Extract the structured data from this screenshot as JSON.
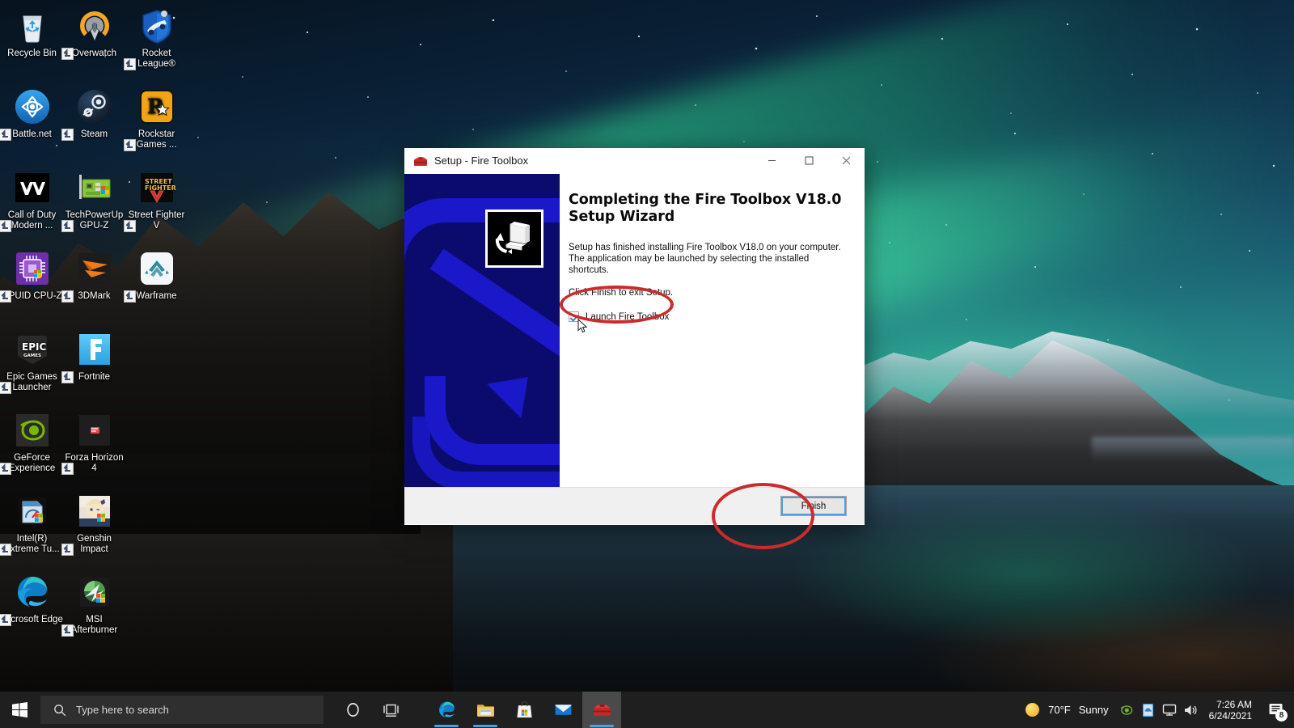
{
  "desktop": {
    "icons": [
      {
        "label": "Recycle Bin",
        "icon": "recycle-bin-icon",
        "shortcut": false,
        "col": 0,
        "row": 0
      },
      {
        "label": "Overwatch",
        "icon": "overwatch-icon",
        "shortcut": true,
        "col": 1,
        "row": 0
      },
      {
        "label": "Rocket League®",
        "icon": "rocket-league-icon",
        "shortcut": true,
        "col": 2,
        "row": 0
      },
      {
        "label": "Battle.net",
        "icon": "battlenet-icon",
        "shortcut": true,
        "col": 0,
        "row": 1
      },
      {
        "label": "Steam",
        "icon": "steam-icon",
        "shortcut": true,
        "col": 1,
        "row": 1
      },
      {
        "label": "Rockstar Games ...",
        "icon": "rockstar-games-icon",
        "shortcut": true,
        "col": 2,
        "row": 1
      },
      {
        "label": "Call of Duty Modern ...",
        "icon": "call-of-duty-icon",
        "shortcut": true,
        "col": 0,
        "row": 2
      },
      {
        "label": "TechPowerUp GPU-Z",
        "icon": "gpu-z-icon",
        "shortcut": true,
        "col": 1,
        "row": 2
      },
      {
        "label": "Street Fighter V",
        "icon": "street-fighter-v-icon",
        "shortcut": true,
        "col": 2,
        "row": 2
      },
      {
        "label": "CPUID CPU-Z",
        "icon": "cpu-z-icon",
        "shortcut": true,
        "col": 0,
        "row": 3
      },
      {
        "label": "3DMark",
        "icon": "3dmark-icon",
        "shortcut": true,
        "col": 1,
        "row": 3
      },
      {
        "label": "Warframe",
        "icon": "warframe-icon",
        "shortcut": true,
        "col": 2,
        "row": 3
      },
      {
        "label": "Epic Games Launcher",
        "icon": "epic-games-icon",
        "shortcut": true,
        "col": 0,
        "row": 4
      },
      {
        "label": "Fortnite",
        "icon": "fortnite-icon",
        "shortcut": true,
        "col": 1,
        "row": 4
      },
      {
        "label": "GeForce Experience",
        "icon": "geforce-experience-icon",
        "shortcut": true,
        "col": 0,
        "row": 5
      },
      {
        "label": "Forza Horizon 4",
        "icon": "forza-horizon-icon",
        "shortcut": true,
        "col": 1,
        "row": 5
      },
      {
        "label": "Intel(R) Extreme Tu...",
        "icon": "intel-xtu-icon",
        "shortcut": true,
        "col": 0,
        "row": 6
      },
      {
        "label": "Genshin Impact",
        "icon": "genshin-impact-icon",
        "shortcut": true,
        "col": 1,
        "row": 6
      },
      {
        "label": "Microsoft Edge",
        "icon": "microsoft-edge-icon",
        "shortcut": true,
        "col": 0,
        "row": 7
      },
      {
        "label": "MSI Afterburner",
        "icon": "msi-afterburner-icon",
        "shortcut": true,
        "col": 1,
        "row": 7
      }
    ]
  },
  "setup_window": {
    "title": "Setup - Fire Toolbox",
    "title_icon": "fire-toolbox-icon",
    "window_buttons": {
      "minimize": "—",
      "maximize": "□",
      "close": "✕"
    },
    "heading": "Completing the Fire Toolbox V18.0 Setup Wizard",
    "paragraph_1": "Setup has finished installing Fire Toolbox V18.0 on your computer. The application may be launched by selecting the installed shortcuts.",
    "paragraph_2": "Click Finish to exit Setup.",
    "launch_checkbox": {
      "label": "Launch Fire Toolbox",
      "checked": true
    },
    "finish_button": "Finish"
  },
  "annotations": {
    "color": "#cc2b2b",
    "shapes": [
      {
        "name": "checkbox-highlight",
        "target": "Launch Fire Toolbox"
      },
      {
        "name": "finish-button-highlight",
        "target": "Finish"
      }
    ]
  },
  "taskbar": {
    "start_icon": "windows-logo-icon",
    "search": {
      "placeholder": "Type here to search",
      "icon": "search-icon"
    },
    "cortana_icon": "cortana-circle-icon",
    "task_view_icon": "task-view-icon",
    "apps": [
      {
        "name": "microsoft-edge-taskbar-icon",
        "label": "Microsoft Edge",
        "running": true,
        "active": false
      },
      {
        "name": "file-explorer-taskbar-icon",
        "label": "File Explorer",
        "running": true,
        "active": false
      },
      {
        "name": "microsoft-store-taskbar-icon",
        "label": "Microsoft Store",
        "running": false,
        "active": false
      },
      {
        "name": "mail-taskbar-icon",
        "label": "Mail",
        "running": false,
        "active": false
      },
      {
        "name": "fire-toolbox-taskbar-icon",
        "label": "Fire Toolbox Setup",
        "running": true,
        "active": true
      }
    ],
    "weather": {
      "icon": "sun-icon",
      "temperature": "70°F",
      "condition": "Sunny"
    },
    "tray_icons": [
      {
        "name": "nvidia-tray-icon"
      },
      {
        "name": "onedrive-tray-icon"
      },
      {
        "name": "network-tray-icon"
      },
      {
        "name": "volume-tray-icon"
      }
    ],
    "clock": {
      "time": "7:26 AM",
      "date": "6/24/2021"
    },
    "notifications": {
      "icon": "action-center-icon",
      "count": "8"
    }
  }
}
